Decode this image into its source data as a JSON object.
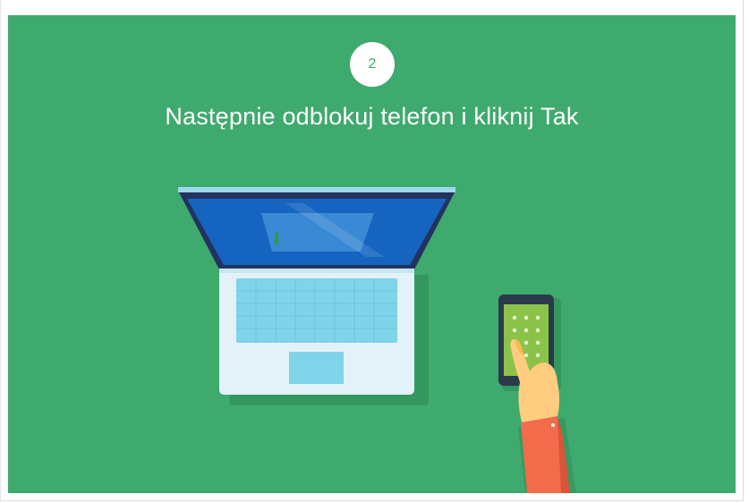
{
  "step": {
    "number": "2",
    "title": "Następnie odblokuj telefon i kliknij Tak"
  },
  "illustration": {
    "laptop": "laptop-illustration",
    "phone": "phone-pattern-lock-illustration",
    "hand": "hand-tapping-illustration"
  },
  "colors": {
    "background": "#3faa6e",
    "laptop_screen": "#1565c0",
    "laptop_body": "#e3f2f8",
    "keyboard": "#80d4ea",
    "phone_screen": "#8bc34a",
    "sleeve": "#f26b4a",
    "skin": "#ffcc80"
  }
}
